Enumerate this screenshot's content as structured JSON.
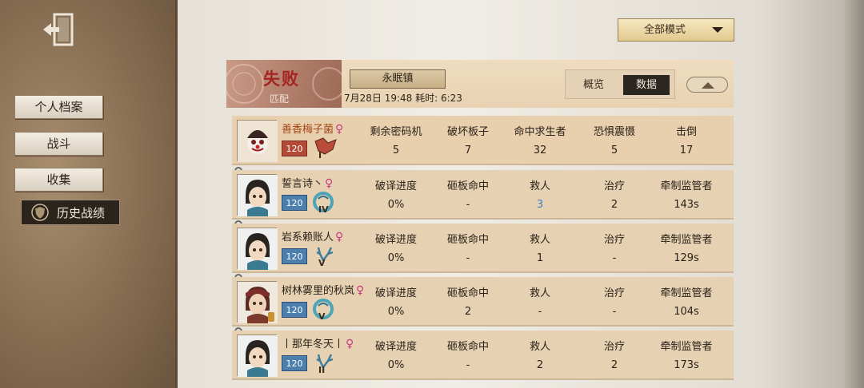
{
  "nav": {
    "exit_icon": "exit-door-icon",
    "items": [
      {
        "label": "个人档案"
      },
      {
        "label": "战斗"
      },
      {
        "label": "收集"
      },
      {
        "label": "历史战绩",
        "icon": "shield-icon"
      }
    ]
  },
  "mode_select": {
    "value": "全部模式"
  },
  "header": {
    "result": "失败",
    "match_type": "匹配",
    "map": "永眠镇",
    "time": "7月28日 19:48 耗时: 6:23",
    "tabs": [
      "概览",
      "数据"
    ],
    "active_tab": "数据"
  },
  "players": [
    {
      "name": "善香梅子菌",
      "gender": "♀",
      "level": "120",
      "rank": "I",
      "role": "hunter",
      "stats": [
        {
          "label": "剩余密码机",
          "value": "5"
        },
        {
          "label": "破坏板子",
          "value": "7"
        },
        {
          "label": "命中求生者",
          "value": "32"
        },
        {
          "label": "恐惧震慑",
          "value": "5"
        },
        {
          "label": "击倒",
          "value": "17"
        }
      ]
    },
    {
      "name": "誓言诗丶",
      "gender": "♀",
      "level": "120",
      "rank": "IV",
      "role": "survivor",
      "stats": [
        {
          "label": "破译进度",
          "value": "0%"
        },
        {
          "label": "砸板命中",
          "value": "-"
        },
        {
          "label": "救人",
          "value": "3",
          "highlight": true
        },
        {
          "label": "治疗",
          "value": "2"
        },
        {
          "label": "牵制监管者",
          "value": "143s"
        }
      ]
    },
    {
      "name": "岩系赖账人",
      "gender": "♀",
      "level": "120",
      "rank": "V",
      "role": "survivor",
      "stats": [
        {
          "label": "破译进度",
          "value": "0%"
        },
        {
          "label": "砸板命中",
          "value": "-"
        },
        {
          "label": "救人",
          "value": "1"
        },
        {
          "label": "治疗",
          "value": "-"
        },
        {
          "label": "牵制监管者",
          "value": "129s"
        }
      ]
    },
    {
      "name": "树林雾里的秋岚",
      "gender": "♀",
      "level": "120",
      "rank": "V",
      "role": "survivor",
      "stats": [
        {
          "label": "破译进度",
          "value": "0%"
        },
        {
          "label": "砸板命中",
          "value": "2"
        },
        {
          "label": "救人",
          "value": "-"
        },
        {
          "label": "治疗",
          "value": "-"
        },
        {
          "label": "牵制监管者",
          "value": "104s"
        }
      ]
    },
    {
      "name": "丨那年冬天丨",
      "gender": "♀",
      "level": "120",
      "rank": "II",
      "role": "survivor",
      "stats": [
        {
          "label": "破译进度",
          "value": "0%"
        },
        {
          "label": "砸板命中",
          "value": "-"
        },
        {
          "label": "救人",
          "value": "2"
        },
        {
          "label": "治疗",
          "value": "2"
        },
        {
          "label": "牵制监管者",
          "value": "173s"
        }
      ]
    }
  ]
}
